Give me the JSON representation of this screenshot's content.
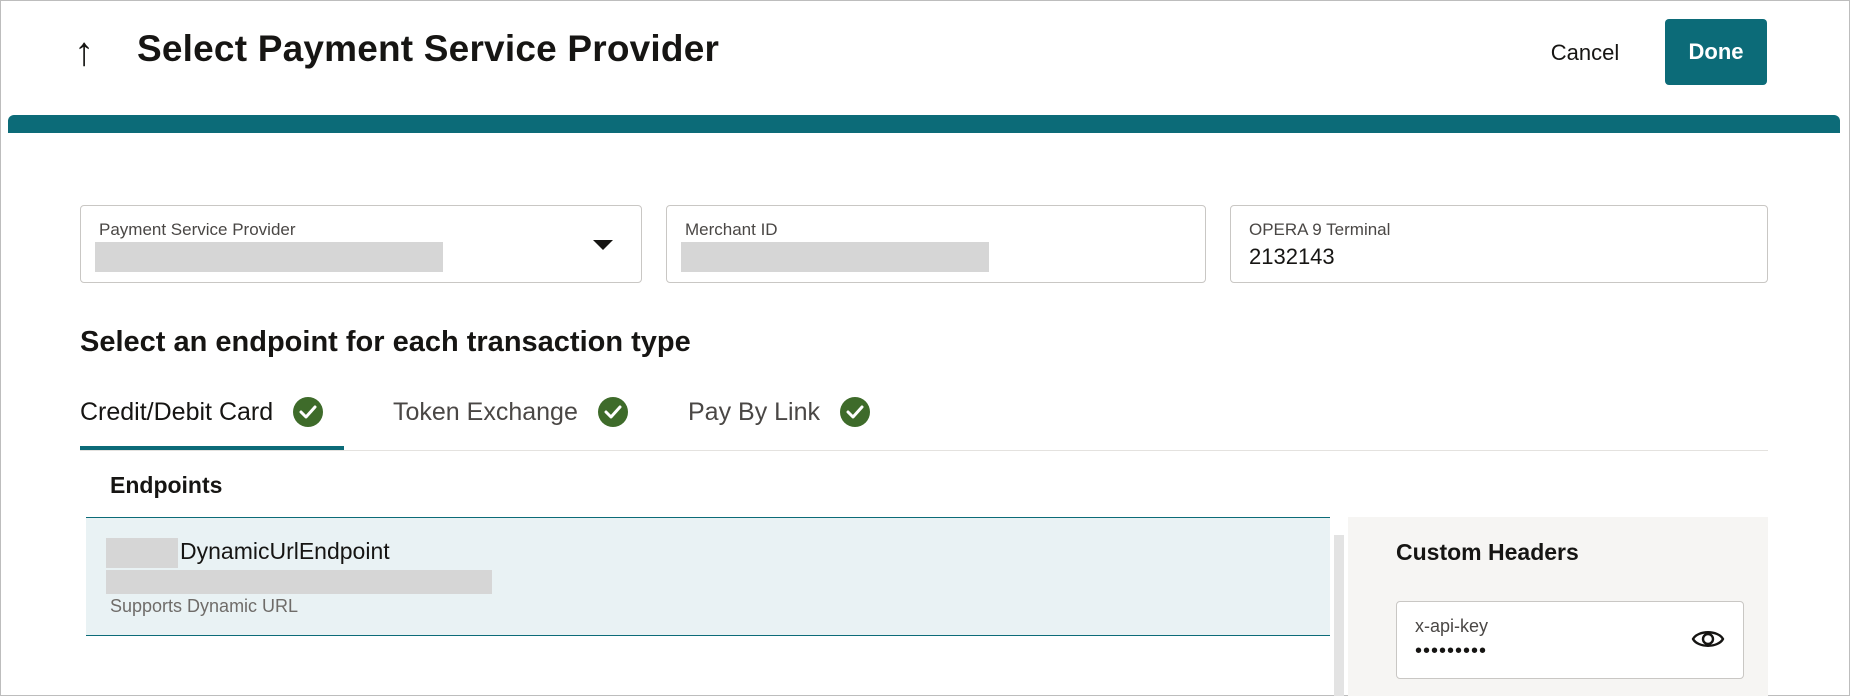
{
  "header": {
    "back_icon": "arrow-up-icon",
    "back_glyph": "↑",
    "title": "Select Payment Service Provider",
    "cancel_label": "Cancel",
    "done_label": "Done"
  },
  "colors": {
    "accent": "#0c6b78",
    "check": "#3e6b2a",
    "selected_row": "#e9f2f4"
  },
  "fields": {
    "psp": {
      "label": "Payment Service Provider",
      "value": ""
    },
    "merchant": {
      "label": "Merchant ID",
      "value": ""
    },
    "terminal": {
      "label": "OPERA 9 Terminal",
      "value": "2132143"
    }
  },
  "section_heading": "Select an endpoint for each transaction type",
  "tabs": [
    {
      "label": "Credit/Debit Card",
      "active": true,
      "status_icon": "check-circle-icon"
    },
    {
      "label": "Token Exchange",
      "active": false,
      "status_icon": "check-circle-icon"
    },
    {
      "label": "Pay By Link",
      "active": false,
      "status_icon": "check-circle-icon"
    }
  ],
  "endpoints": {
    "heading": "Endpoints",
    "items": [
      {
        "name": "DynamicUrlEndpoint",
        "description": "Supports Dynamic URL"
      }
    ]
  },
  "custom_headers": {
    "title": "Custom Headers",
    "items": [
      {
        "key": "x-api-key",
        "value": "•••••••••",
        "icon": "eye-icon"
      }
    ]
  }
}
